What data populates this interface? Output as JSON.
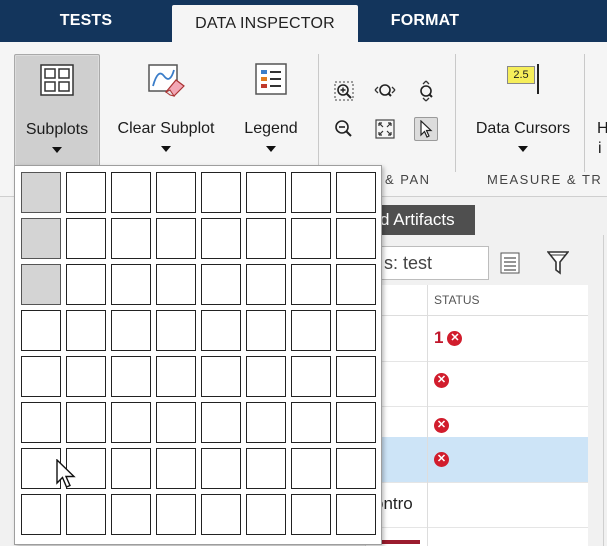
{
  "tabs": [
    {
      "label": "TESTS",
      "active": false
    },
    {
      "label": "DATA INSPECTOR",
      "active": true
    },
    {
      "label": "FORMAT",
      "active": false
    }
  ],
  "ribbon": {
    "subplots_label": "Subplots",
    "clear_subplot_label": "Clear Subplot",
    "legend_label": "Legend",
    "data_cursors_label": "Data Cursors",
    "data_cursors_value": "2.5",
    "cutoff_label_1": "H",
    "cutoff_label_2": "i",
    "zoom_pan_group": "& PAN",
    "measure_group": "MEASURE & TR"
  },
  "workspace": {
    "artifacts_tab": "d Artifacts",
    "filter_text": "s: test",
    "status_header": "STATUS",
    "rows": [
      {
        "status_count": "1",
        "failed": true,
        "text": "",
        "highlight": false
      },
      {
        "status_count": "",
        "failed": true,
        "text": "",
        "highlight": false
      },
      {
        "status_count": "",
        "failed": true,
        "text": "",
        "highlight": false
      },
      {
        "status_count": "",
        "failed": true,
        "text": "",
        "highlight": true
      },
      {
        "status_count": "",
        "failed": false,
        "text": "ontro",
        "highlight": false
      }
    ]
  },
  "subplot_grid": {
    "rows": 8,
    "cols": 8,
    "selected_rows": 3,
    "selected_cols": 1
  },
  "colors": {
    "tabbar": "#13355c",
    "status_error": "#d11d2d",
    "row_highlight": "#cde4f7"
  }
}
